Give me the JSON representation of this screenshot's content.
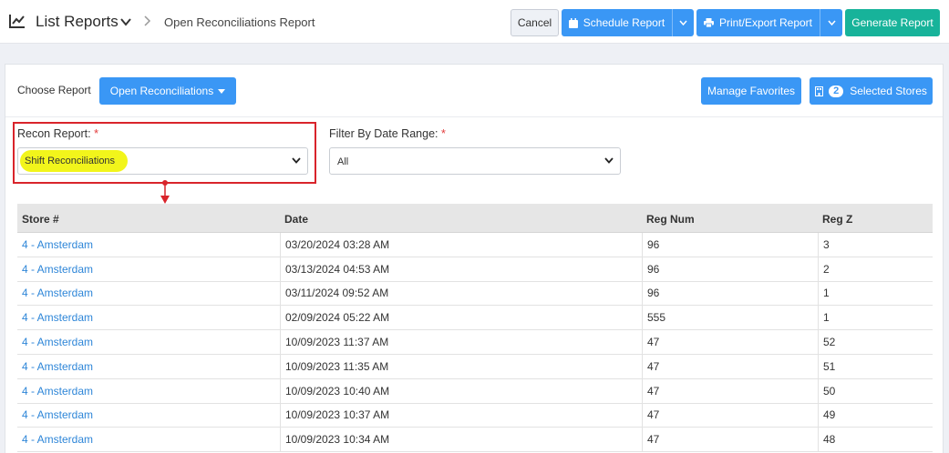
{
  "header": {
    "title": "List Reports",
    "breadcrumb": "Open Reconciliations Report",
    "cancel_label": "Cancel",
    "schedule_label": "Schedule Report",
    "print_label": "Print/Export Report",
    "generate_label": "Generate Report"
  },
  "toolbar": {
    "choose_label": "Choose Report",
    "report_dropdown": "Open Reconciliations",
    "favorites_label": "Manage Favorites",
    "stores_count": "2",
    "stores_label": "Selected Stores"
  },
  "filters": {
    "recon_label": "Recon Report:",
    "recon_value": "Shift Reconciliations",
    "date_label": "Filter By Date Range:",
    "date_value": "All",
    "required_mark": "*"
  },
  "table": {
    "columns": [
      "Store #",
      "Date",
      "Reg Num",
      "Reg Z"
    ],
    "rows": [
      [
        "4 - Amsterdam",
        "03/20/2024 03:28 AM",
        "96",
        "3"
      ],
      [
        "4 - Amsterdam",
        "03/13/2024 04:53 AM",
        "96",
        "2"
      ],
      [
        "4 - Amsterdam",
        "03/11/2024 09:52 AM",
        "96",
        "1"
      ],
      [
        "4 - Amsterdam",
        "02/09/2024 05:22 AM",
        "555",
        "1"
      ],
      [
        "4 - Amsterdam",
        "10/09/2023 11:37 AM",
        "47",
        "52"
      ],
      [
        "4 - Amsterdam",
        "10/09/2023 11:35 AM",
        "47",
        "51"
      ],
      [
        "4 - Amsterdam",
        "10/09/2023 10:40 AM",
        "47",
        "50"
      ],
      [
        "4 - Amsterdam",
        "10/09/2023 10:37 AM",
        "47",
        "49"
      ],
      [
        "4 - Amsterdam",
        "10/09/2023 10:34 AM",
        "47",
        "48"
      ]
    ]
  },
  "colors": {
    "primary": "#3a97f5",
    "success": "#17b39a",
    "highlight": "#f2f51b",
    "annotation": "#d9242b",
    "link": "#2e86d8"
  },
  "icons": {
    "title": "line-chart-icon",
    "schedule": "calendar-icon",
    "print": "printer-icon",
    "stores": "store-icon"
  }
}
